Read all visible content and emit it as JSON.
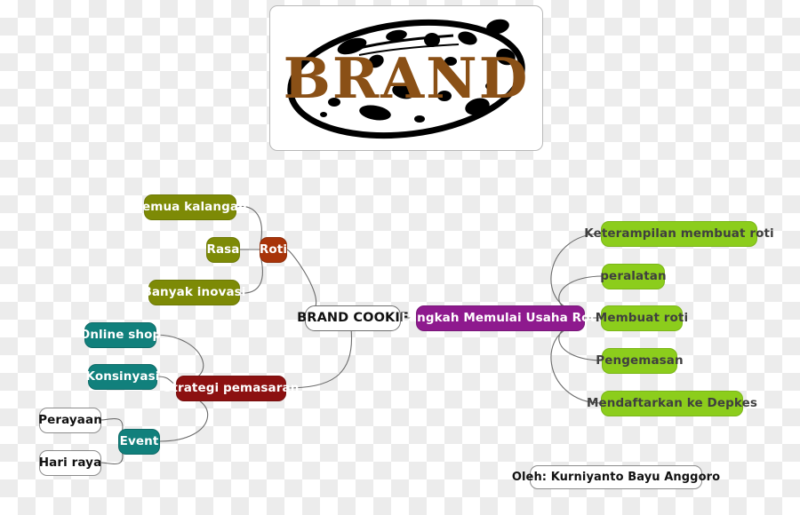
{
  "document": {
    "type": "mind-map",
    "title": "BRAND COOKIE",
    "background": "transparency-checkerboard"
  },
  "logo": {
    "name": "brand-cookie-logo",
    "word": "BRAND",
    "description": "Chocolate-chip cookie oval with the word BRAND",
    "text_color": "#8a5016",
    "cookie_color": "#000000"
  },
  "colors": {
    "olive": "#7d8a06",
    "brick": "#a83409",
    "teal": "#11807c",
    "darkred": "#8c1111",
    "purple": "#8e1a8e",
    "lime": "#8ccd1c",
    "white": "#ffffff",
    "edge": "#6b6b6b"
  },
  "center": {
    "label": "BRAND COOKIE"
  },
  "branches": {
    "roti": {
      "label": "Roti",
      "color": "brick",
      "children": [
        {
          "label": "Semua kalangan",
          "color": "olive"
        },
        {
          "label": "Rasa",
          "color": "olive"
        },
        {
          "label": "Banyak inovasi",
          "color": "olive"
        }
      ]
    },
    "strategi_pemasaran": {
      "label": "Strategi pemasaran",
      "color": "darkred",
      "children": [
        {
          "label": "Online shop",
          "color": "teal"
        },
        {
          "label": "Konsinyasi",
          "color": "teal"
        },
        {
          "label": "Event",
          "color": "teal",
          "children": [
            {
              "label": "Perayaan",
              "color": "white"
            },
            {
              "label": "Hari raya",
              "color": "white"
            }
          ]
        }
      ]
    },
    "langkah_memulai_usaha_roti": {
      "label": "Langkah Memulai Usaha Roti",
      "color": "purple",
      "children": [
        {
          "label": "Keterampilan membuat roti",
          "color": "lime"
        },
        {
          "label": "peralatan",
          "color": "lime"
        },
        {
          "label": "Membuat roti",
          "color": "lime"
        },
        {
          "label": "Pengemasan",
          "color": "lime"
        },
        {
          "label": "Mendaftarkan ke Depkes",
          "color": "lime"
        }
      ]
    }
  },
  "credit": {
    "label": "Oleh: Kurniyanto Bayu Anggoro"
  }
}
